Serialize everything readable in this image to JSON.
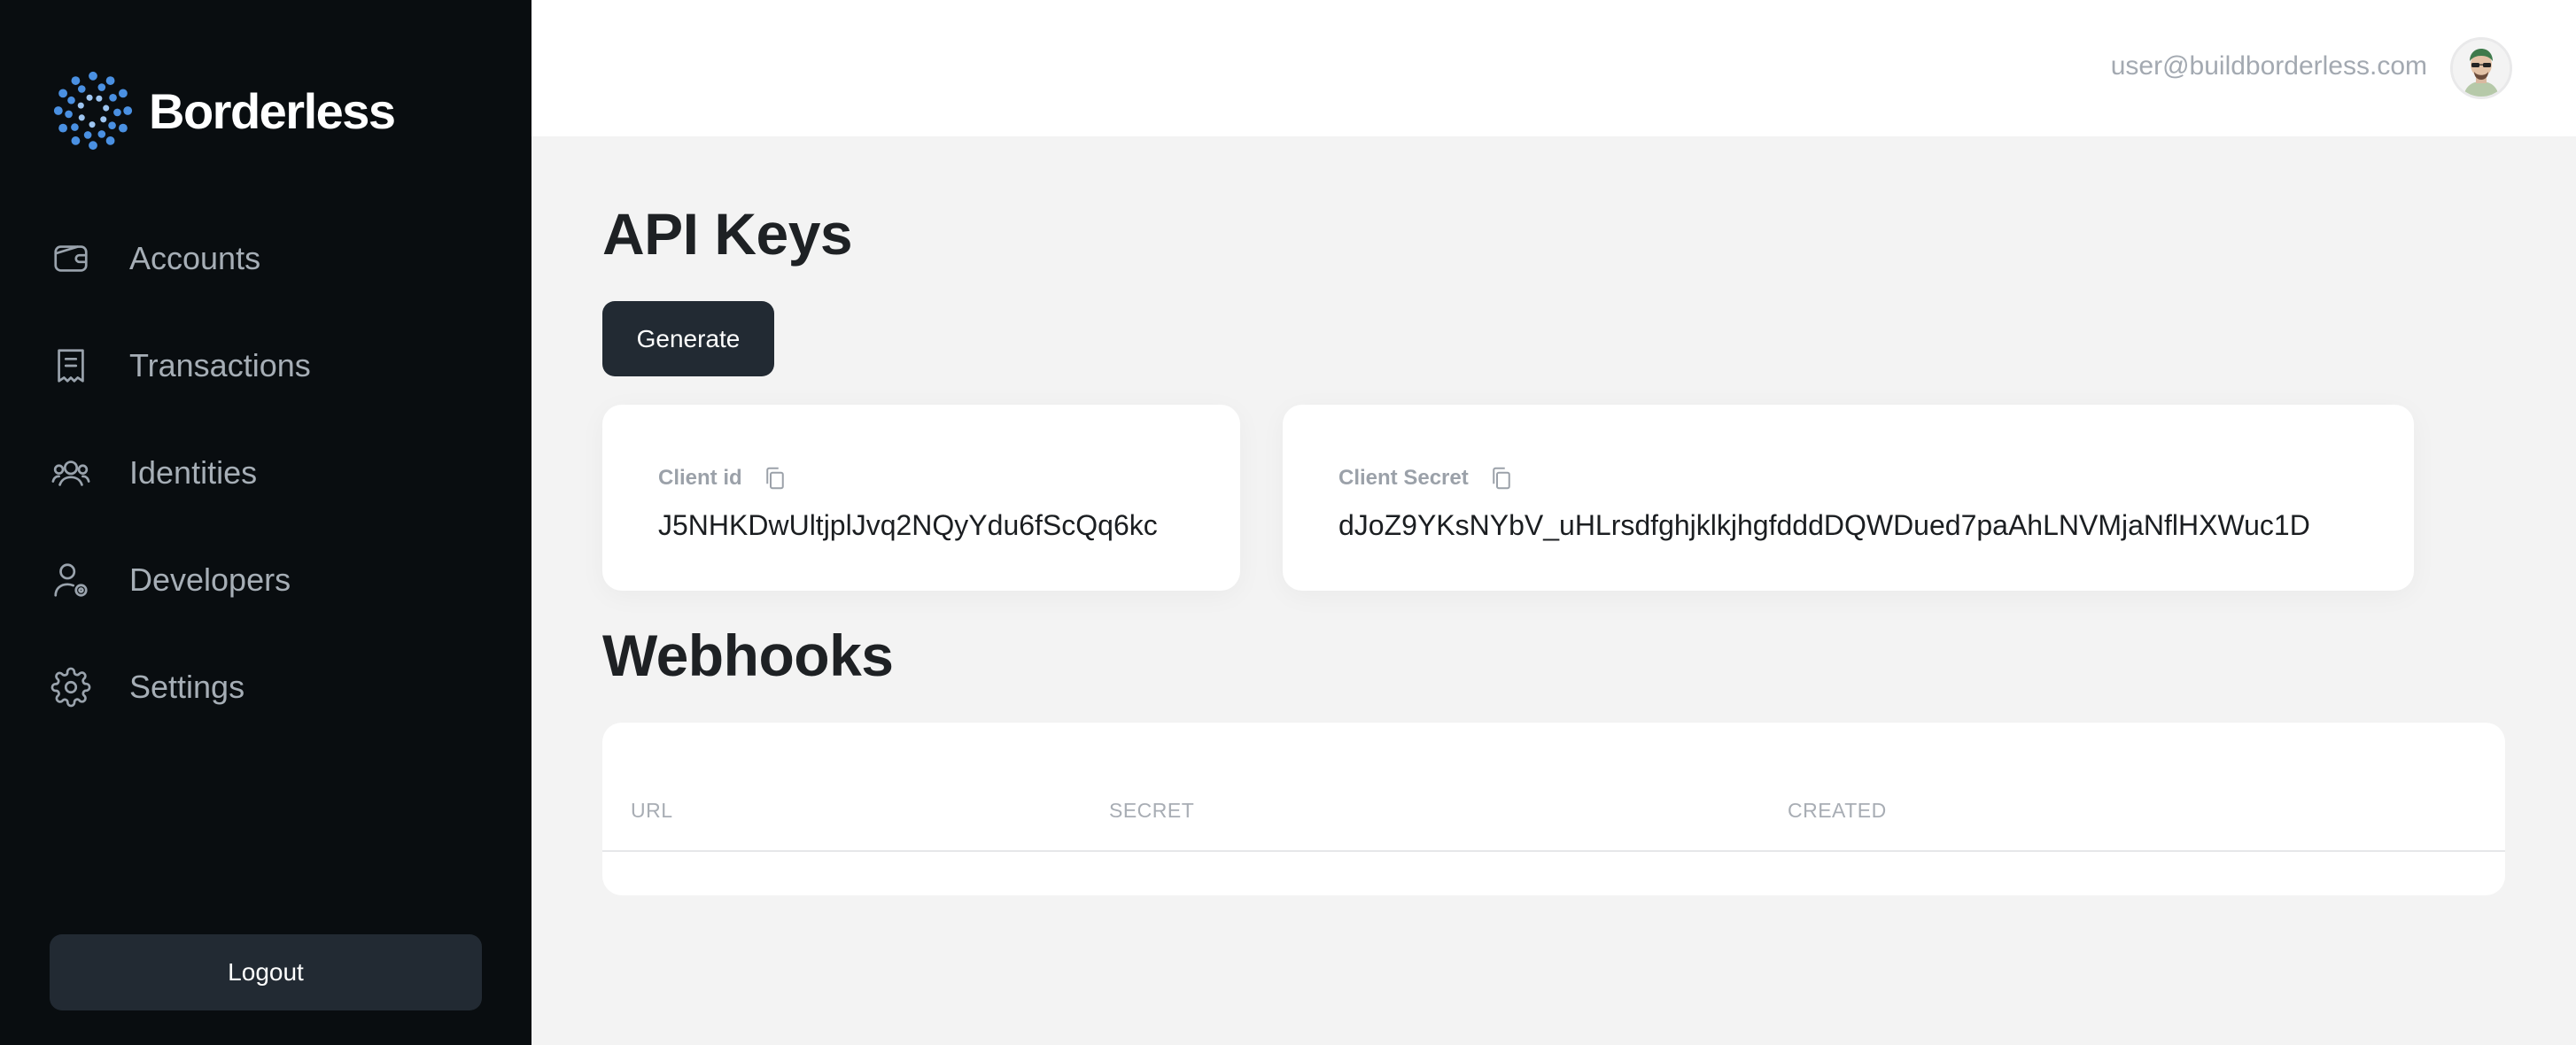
{
  "brand": {
    "name": "Borderless",
    "accent": "#4a90e2"
  },
  "sidebar": {
    "items": [
      {
        "label": "Accounts",
        "icon": "wallet-icon"
      },
      {
        "label": "Transactions",
        "icon": "receipt-icon"
      },
      {
        "label": "Identities",
        "icon": "users-icon"
      },
      {
        "label": "Developers",
        "icon": "user-settings-icon"
      },
      {
        "label": "Settings",
        "icon": "gear-icon"
      }
    ],
    "logout_label": "Logout"
  },
  "header": {
    "user_email": "user@buildborderless.com"
  },
  "api_keys": {
    "title": "API Keys",
    "generate_label": "Generate",
    "client_id": {
      "label": "Client id",
      "value": "J5NHKDwUltjplJvq2NQyYdu6fScQq6kc"
    },
    "client_secret": {
      "label": "Client Secret",
      "value": "dJoZ9YKsNYbV_uHLrsdfghjklkjhgfdddDQWDued7paAhLNVMjaNflHXWuc1D"
    }
  },
  "webhooks": {
    "title": "Webhooks",
    "columns": [
      "URL",
      "SECRET",
      "CREATED"
    ],
    "rows": []
  }
}
